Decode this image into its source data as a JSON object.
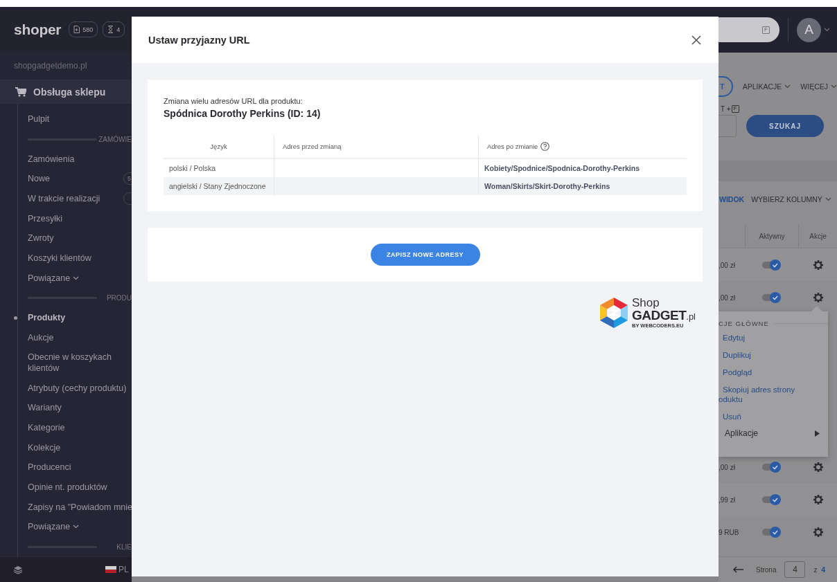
{
  "sidebar": {
    "logo": "shoper",
    "counters": [
      {
        "kind": "document",
        "count": "580"
      },
      {
        "kind": "hourglass",
        "count": "4"
      }
    ],
    "store": "shopgadgetdemo.pl",
    "section": "Obsługa sklepu",
    "items": [
      {
        "kind": "link",
        "label": "Pulpit",
        "selected": false
      },
      {
        "kind": "heading",
        "label": "ZAMÓWIE"
      },
      {
        "kind": "link",
        "label": "Zamówienia",
        "selected": false
      },
      {
        "kind": "link",
        "label": "Nowe",
        "selected": false,
        "has_badge": true,
        "badge": "5"
      },
      {
        "kind": "link",
        "label": "W trakcie realizacji",
        "selected": false,
        "has_badge": true
      },
      {
        "kind": "link",
        "label": "Przesyłki",
        "selected": false
      },
      {
        "kind": "link",
        "label": "Zwroty",
        "selected": false
      },
      {
        "kind": "link",
        "label": "Koszyki klientów",
        "selected": false
      },
      {
        "kind": "group",
        "label": "Powiązane",
        "selected": false
      },
      {
        "kind": "heading",
        "label": "PRODU"
      },
      {
        "kind": "link",
        "label": "Produkty",
        "selected": true
      },
      {
        "kind": "link",
        "label": "Aukcje",
        "selected": false
      },
      {
        "kind": "link",
        "label": "Obecnie w koszykach klientów",
        "selected": false
      },
      {
        "kind": "link",
        "label": "Atrybuty (cechy produktu)",
        "selected": false
      },
      {
        "kind": "link",
        "label": "Warianty",
        "selected": false
      },
      {
        "kind": "link",
        "label": "Kategorie",
        "selected": false
      },
      {
        "kind": "link",
        "label": "Kolekcje",
        "selected": false
      },
      {
        "kind": "link",
        "label": "Producenci",
        "selected": false
      },
      {
        "kind": "link",
        "label": "Opinie nt. produktów",
        "selected": false
      },
      {
        "kind": "link",
        "label": "Zapisy na \"Powiadom mnie",
        "selected": false
      },
      {
        "kind": "group",
        "label": "Powiązane",
        "selected": false
      },
      {
        "kind": "heading",
        "label": "KLIE"
      }
    ],
    "language": "PL"
  },
  "main": {
    "search": {
      "shortcut": "F"
    },
    "avatar": "A",
    "toolbar": [
      {
        "kind": "outline",
        "label": "T"
      },
      {
        "kind": "dropdown",
        "label": "APLIKACJE"
      },
      {
        "kind": "dropdown",
        "label": "WIĘCEJ"
      }
    ],
    "search_hint": {
      "text": "T + ",
      "shortcut": "F"
    },
    "search_button": "SZUKAJ",
    "view_actions": [
      {
        "kind": "link",
        "label": "WIDOK"
      },
      {
        "kind": "dropdown",
        "label": "WYBIERZ KOLUMNY"
      }
    ],
    "columns": [
      "Aktywny",
      "Akcje"
    ],
    "rows": [
      {
        "price": ",00 zł",
        "active": true
      },
      {
        "price": ",00 zł",
        "active": true,
        "menu": {
          "heading": "CJE GŁÓWNE",
          "items": [
            {
              "kind": "link",
              "label": "Edytuj"
            },
            {
              "kind": "link",
              "label": "Duplikuj"
            },
            {
              "kind": "link",
              "label": "Podgląd"
            },
            {
              "kind": "link",
              "label": "Skopiuj adres strony\noduktu"
            },
            {
              "kind": "link",
              "label": "Usuń"
            },
            {
              "kind": "submenu",
              "label": "Aplikacje"
            }
          ]
        }
      },
      {
        "price": ",00 zł",
        "active": true
      },
      {
        "price": ",99 zł",
        "active": true
      },
      {
        "price": "9 RUB",
        "active": true
      }
    ],
    "pagination": {
      "label": "Strona",
      "page": "4",
      "of": "z",
      "total": "4"
    }
  },
  "modal": {
    "title": "Ustaw przyjazny URL",
    "intro": "Zmiana wielu adresów URL dla produktu:",
    "product": "Spódnica Dorothy Perkins (ID: 14)",
    "columns": [
      {
        "label": "Język",
        "help": false
      },
      {
        "label": "Adres przed zmianą",
        "help": false
      },
      {
        "label": "Adres po zmianie",
        "help": true
      }
    ],
    "rows": [
      {
        "language": "polski / Polska",
        "after": "Kobiety/Spodnice/Spodnica-Dorothy-Perkins"
      },
      {
        "language": "angielski / Stany Zjednoczone",
        "after": "Woman/Skirts/Skirt-Dorothy-Perkins"
      }
    ],
    "save_button": "ZAPISZ NOWE ADRESY",
    "brand": {
      "name": "Shop",
      "name_bold": "GADGET",
      "suffix": ".pl",
      "byline": "BY WEBCODERS.EU"
    }
  }
}
